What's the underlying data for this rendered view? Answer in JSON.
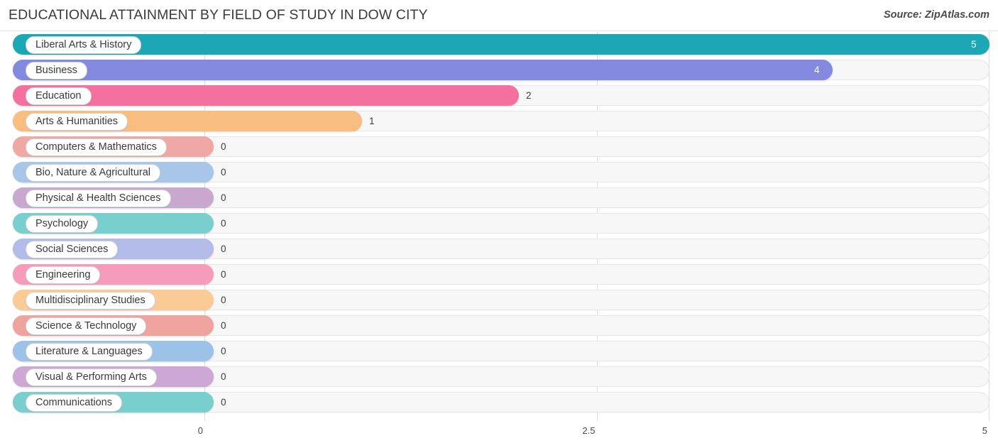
{
  "header": {
    "title": "EDUCATIONAL ATTAINMENT BY FIELD OF STUDY IN DOW CITY",
    "source": "Source: ZipAtlas.com"
  },
  "chart_data": {
    "type": "bar",
    "orientation": "horizontal",
    "title": "EDUCATIONAL ATTAINMENT BY FIELD OF STUDY IN DOW CITY",
    "xlabel": "",
    "ylabel": "",
    "xlim": [
      0,
      5
    ],
    "ticks": [
      "0",
      "2.5",
      "5"
    ],
    "tick_values": [
      0,
      2.5,
      5
    ],
    "grid": true,
    "legend": "none",
    "categories": [
      "Liberal Arts & History",
      "Business",
      "Education",
      "Arts & Humanities",
      "Computers & Mathematics",
      "Bio, Nature & Agricultural",
      "Physical & Health Sciences",
      "Psychology",
      "Social Sciences",
      "Engineering",
      "Multidisciplinary Studies",
      "Science & Technology",
      "Literature & Languages",
      "Visual & Performing Arts",
      "Communications"
    ],
    "values": [
      5,
      4,
      2,
      1,
      0,
      0,
      0,
      0,
      0,
      0,
      0,
      0,
      0,
      0,
      0
    ],
    "value_labels": [
      "5",
      "4",
      "2",
      "1",
      "0",
      "0",
      "0",
      "0",
      "0",
      "0",
      "0",
      "0",
      "0",
      "0",
      "0"
    ],
    "colors": [
      "#1ba7b3",
      "#8289de",
      "#f4709e",
      "#f8bd7f",
      "#f0a8a4",
      "#a8c6e8",
      "#c9a8cf",
      "#79cfce",
      "#b3bbe8",
      "#f59bbc",
      "#fbcb96",
      "#efa39e",
      "#9dc2e8",
      "#cda8d4",
      "#7acece"
    ],
    "bars": [
      {
        "label": "Liberal Arts & History",
        "value": 5,
        "value_label": "5",
        "color": "#1ba7b3",
        "label_inside": true
      },
      {
        "label": "Business",
        "value": 4,
        "value_label": "4",
        "color": "#8289de",
        "label_inside": true
      },
      {
        "label": "Education",
        "value": 2,
        "value_label": "2",
        "color": "#f4709e",
        "label_inside": false
      },
      {
        "label": "Arts & Humanities",
        "value": 1,
        "value_label": "1",
        "color": "#f8bd7f",
        "label_inside": false
      },
      {
        "label": "Computers & Mathematics",
        "value": 0,
        "value_label": "0",
        "color": "#f0a8a4",
        "label_inside": false
      },
      {
        "label": "Bio, Nature & Agricultural",
        "value": 0,
        "value_label": "0",
        "color": "#a8c6e8",
        "label_inside": false
      },
      {
        "label": "Physical & Health Sciences",
        "value": 0,
        "value_label": "0",
        "color": "#c9a8cf",
        "label_inside": false
      },
      {
        "label": "Psychology",
        "value": 0,
        "value_label": "0",
        "color": "#79cfce",
        "label_inside": false
      },
      {
        "label": "Social Sciences",
        "value": 0,
        "value_label": "0",
        "color": "#b3bbe8",
        "label_inside": false
      },
      {
        "label": "Engineering",
        "value": 0,
        "value_label": "0",
        "color": "#f59bbc",
        "label_inside": false
      },
      {
        "label": "Multidisciplinary Studies",
        "value": 0,
        "value_label": "0",
        "color": "#fbcb96",
        "label_inside": false
      },
      {
        "label": "Science & Technology",
        "value": 0,
        "value_label": "0",
        "color": "#efa39e",
        "label_inside": false
      },
      {
        "label": "Literature & Languages",
        "value": 0,
        "value_label": "0",
        "color": "#9dc2e8",
        "label_inside": false
      },
      {
        "label": "Visual & Performing Arts",
        "value": 0,
        "value_label": "0",
        "color": "#cda8d4",
        "label_inside": false
      },
      {
        "label": "Communications",
        "value": 0,
        "value_label": "0",
        "color": "#7acece",
        "label_inside": false
      }
    ]
  }
}
